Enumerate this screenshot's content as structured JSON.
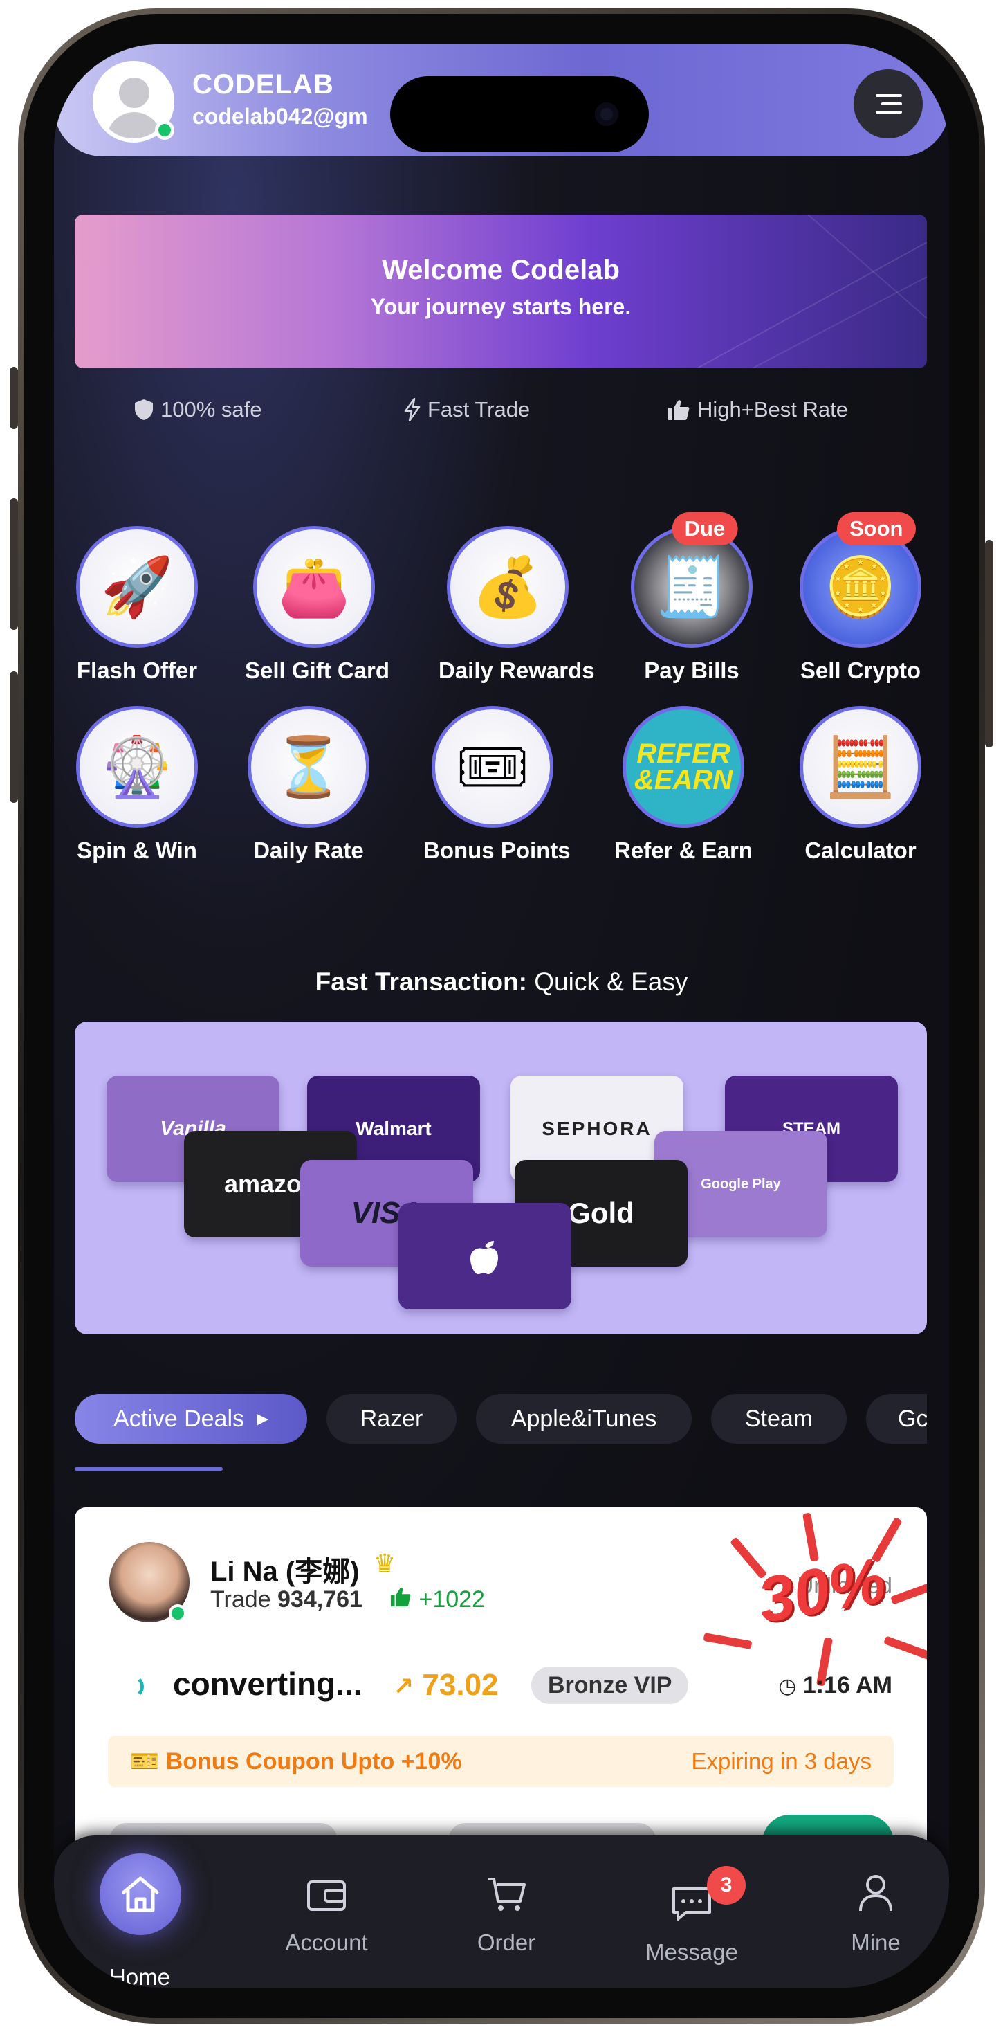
{
  "header": {
    "user_name": "CODELAB",
    "user_email": "codelab042@gm"
  },
  "banner": {
    "title": "Welcome Codelab",
    "subtitle": "Your journey starts here."
  },
  "features": [
    {
      "label": "100% safe",
      "icon": "shield-icon"
    },
    {
      "label": "Fast Trade",
      "icon": "bolt-icon"
    },
    {
      "label": "High+Best Rate",
      "icon": "thumbs-up-icon"
    }
  ],
  "services": [
    {
      "label": "Flash Offer",
      "icon": "rocket-icon",
      "glyph": "🚀"
    },
    {
      "label": "Sell Gift Card",
      "icon": "wallet-icon",
      "glyph": "👛"
    },
    {
      "label": "Daily Rewards",
      "icon": "gold-bag-icon",
      "glyph": "💰"
    },
    {
      "label": "Pay Bills",
      "icon": "pay-bills-icon",
      "glyph": "🧾",
      "tag": "Due"
    },
    {
      "label": "Sell Crypto",
      "icon": "crypto-coins-icon",
      "glyph": "🪙",
      "tag": "Soon"
    },
    {
      "label": "Spin & Win",
      "icon": "spin-wheel-icon",
      "glyph": "🎡"
    },
    {
      "label": "Daily Rate",
      "icon": "hourglass-icon",
      "glyph": "⏳"
    },
    {
      "label": "Bonus Points",
      "icon": "coupons-icon",
      "glyph": "🎟"
    },
    {
      "label": "Refer & Earn",
      "icon": "refer-earn-icon",
      "glyph": "REFER\n&EARN"
    },
    {
      "label": "Calculator",
      "icon": "calculator-icon",
      "glyph": "🧮"
    }
  ],
  "section": {
    "title_bold": "Fast Transaction:",
    "title_rest": " Quick & Easy"
  },
  "gift_cards": [
    "Vanilla",
    "Walmart",
    "SEPHORA",
    "STEAM",
    "amazon",
    "VISA",
    "Gold",
    "Google Play",
    ""
  ],
  "tabs": [
    "Active Deals",
    "Razer",
    "Apple&iTunes",
    "Steam",
    "Gc"
  ],
  "deal": {
    "trader": "Li Na (李娜)",
    "trade_label": "Trade",
    "trade_count": "934,761",
    "likes": "+1022",
    "limit": "Unlimited",
    "promo": "30%",
    "status": "converting...",
    "rate": "73.02",
    "tier": "Bronze VIP",
    "time": "1:16 AM",
    "coupon": "Bonus Coupon Upto +10%",
    "expiry": "Expiring in 3 days"
  },
  "nav": [
    {
      "label": "Home",
      "icon": "home-icon"
    },
    {
      "label": "Account",
      "icon": "wallet-icon"
    },
    {
      "label": "Order",
      "icon": "cart-icon"
    },
    {
      "label": "Message",
      "icon": "message-icon",
      "badge": "3"
    },
    {
      "label": "Mine",
      "icon": "person-icon"
    }
  ],
  "colors": {
    "accent": "#6c6ad8",
    "screen_bg": "#0f0f15",
    "rate": "#f0a11a",
    "danger": "#f04a4a",
    "success": "#13a13c"
  }
}
